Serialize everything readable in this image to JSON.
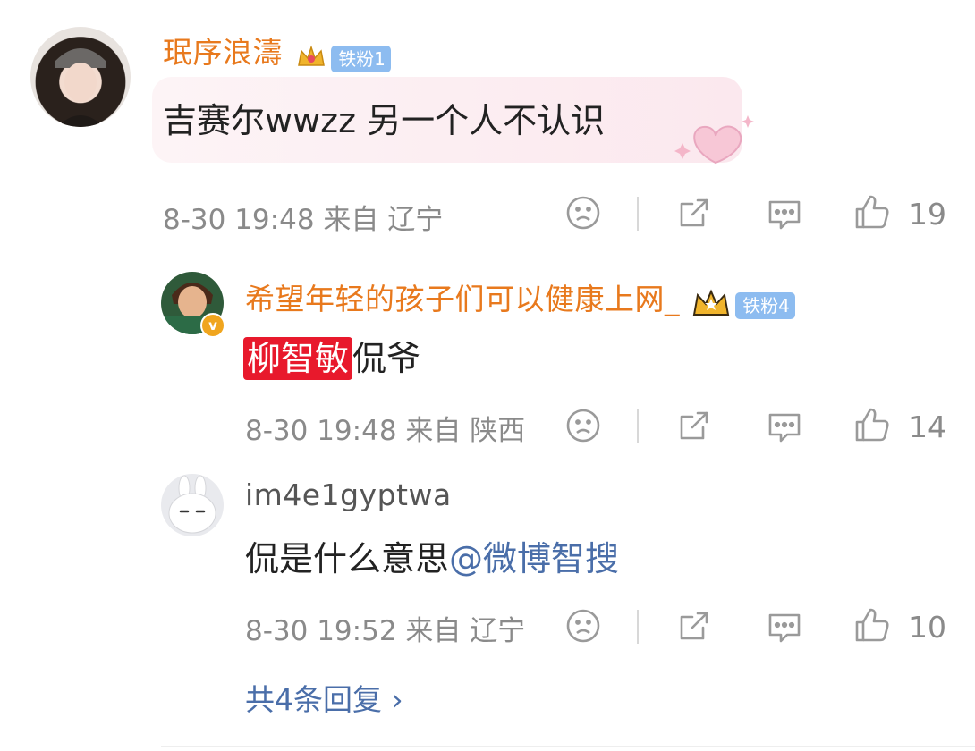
{
  "comments": [
    {
      "user": "珉序浪濤",
      "badge": "铁粉1",
      "text": "吉赛尔wwzz 另一个人不认识",
      "meta": "8-30 19:48 来自 辽宁",
      "likes": "19"
    },
    {
      "user": "希望年轻的孩子们可以健康上网_",
      "badge": "铁粉4",
      "highlight": "柳智敏",
      "text_rest": "侃爷",
      "meta": "8-30 19:48 来自 陕西",
      "likes": "14"
    },
    {
      "user": "im4e1gyptwa",
      "text": "侃是什么意思",
      "mention": "@微博智搜",
      "meta": "8-30 19:52 来自 辽宁",
      "likes": "10"
    }
  ],
  "more_replies": "共4条回复 ›",
  "icons": [
    "sad-face-icon",
    "share-icon",
    "comment-icon",
    "like-icon"
  ],
  "colors": {
    "username": "#e8791d",
    "badge": "#8dbcf0",
    "highlight": "#e8192c",
    "link": "#4a6ea9",
    "meta": "#8a8a8a"
  }
}
